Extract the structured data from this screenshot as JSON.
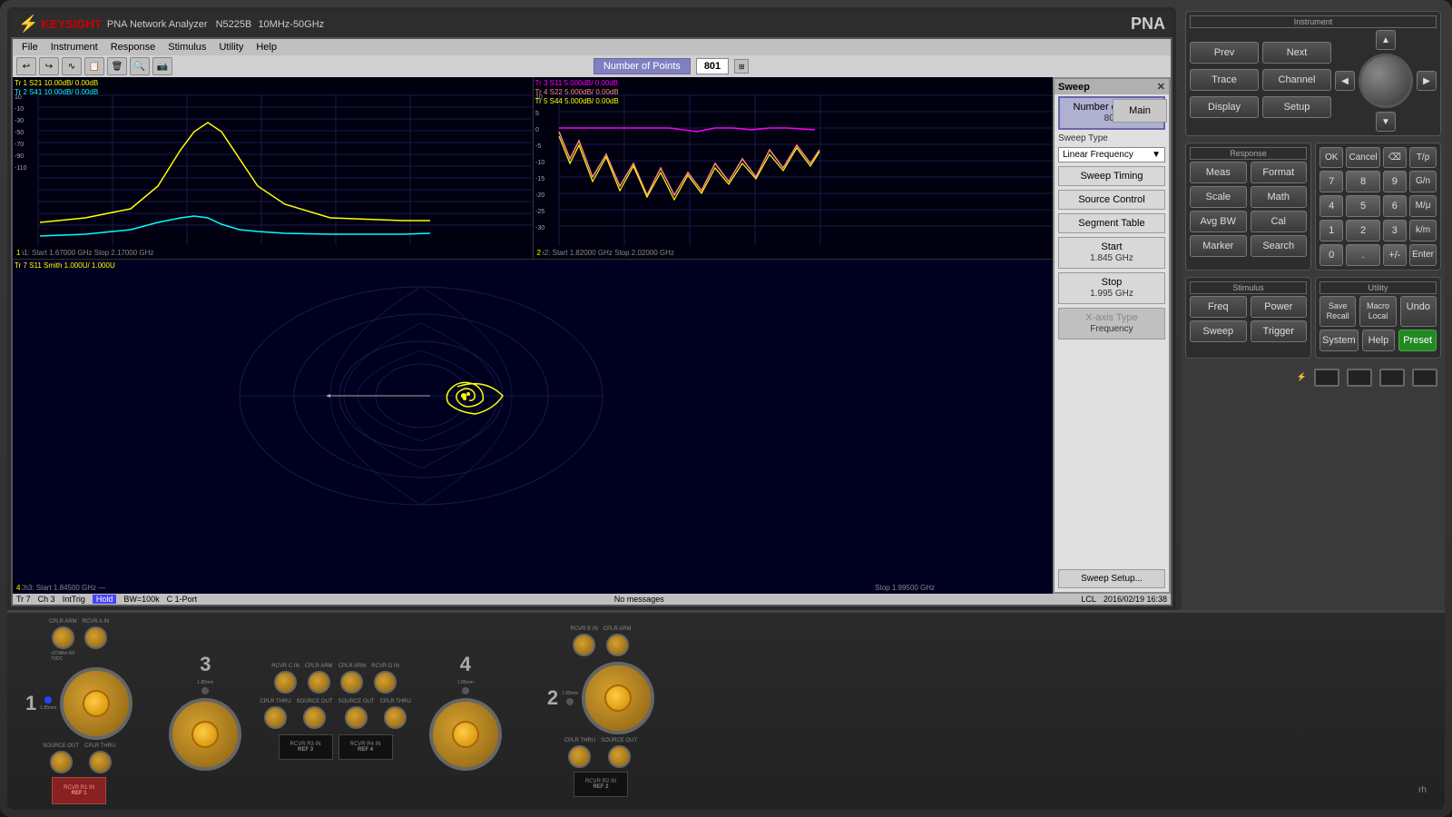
{
  "header": {
    "brand": "KEYSIGHT",
    "model": "PNA Network Analyzer",
    "series": "N5225B",
    "freq_range": "10MHz-50GHz",
    "pna_label": "PNA"
  },
  "menu": {
    "items": [
      "File",
      "Instrument",
      "Response",
      "Stimulus",
      "Utility",
      "Help"
    ]
  },
  "toolbar": {
    "buttons": [
      "↩",
      "↪",
      "〜",
      "📋",
      "🗑",
      "🔍",
      "📷"
    ]
  },
  "nop_bar": {
    "label": "Number of Points",
    "value": "801"
  },
  "sweep_panel": {
    "title": "Sweep",
    "close": "✕",
    "nop_label": "Number of Points",
    "nop_value": "801",
    "sweep_type_label": "Sweep Type",
    "sweep_type_value": "Linear Frequency",
    "main_btn": "Main",
    "sweep_timing_btn": "Sweep Timing",
    "source_control_btn": "Source Control",
    "segment_table_btn": "Segment Table",
    "start_label": "Start",
    "start_value": "1.845 GHz",
    "stop_label": "Stop",
    "stop_value": "1.995 GHz",
    "x_axis_label": "X-axis Type",
    "x_axis_value": "Frequency",
    "sweep_setup_btn": "Sweep Setup..."
  },
  "charts": {
    "chart1": {
      "trace1": "Tr 1  S21 10.00dB/ 0.00dB",
      "trace2": "Tr 2  S41 10.00dB/ 0.00dB",
      "bottom": "Ch1: Start 1.67000 GHz      Stop 2.17000 GHz"
    },
    "chart2": {
      "trace3": "Tr 3  S11 5.000dB/ 0.00dB",
      "trace4": "Tr 4  S22 5.000dB/ 0.00dB",
      "trace5": "Tr 5  S44 5.000dB/ 0.00dB",
      "bottom": "Ch2: Start 1.82000 GHz      Stop 2.02000 GHz"
    },
    "chart3": {
      "trace": "Tr 7   S11 Smith 1.000U/ 1.000U",
      "bottom_left": ">Ch3: Start 1.84500 GHz —",
      "bottom_right": "Stop 1.99500 GHz"
    }
  },
  "status_bar": {
    "items": [
      "Tr 7",
      "Ch 3",
      "IntTrig",
      "Hold",
      "BW=100k",
      "C 1-Port",
      "No messages",
      "LCL",
      "2016/02/19 16:38"
    ]
  },
  "instrument_panel": {
    "section_label": "Instrument",
    "prev_btn": "Prev",
    "next_btn": "Next",
    "trace_btn": "Trace",
    "channel_btn": "Channel",
    "display_btn": "Display",
    "setup_btn": "Setup"
  },
  "response_panel": {
    "section_label": "Response",
    "meas_btn": "Meas",
    "format_btn": "Format",
    "scale_btn": "Scale",
    "math_btn": "Math",
    "avg_bw_btn": "Avg BW",
    "cal_btn": "Cal",
    "marker_btn": "Marker",
    "search_btn": "Search"
  },
  "keypad": {
    "ok_btn": "OK",
    "cancel_btn": "Cancel",
    "backspace_btn": "⌫",
    "tp_btn": "T/p",
    "k7": "7",
    "k8": "8",
    "k9": "9",
    "gn_btn": "G/n",
    "k4": "4",
    "k5": "5",
    "k6": "6",
    "mu_btn": "M/μ",
    "k1": "1",
    "k2": "2",
    "k3": "3",
    "km_btn": "k/m",
    "k0": "0",
    "dot_btn": ".",
    "plusminus_btn": "+/-",
    "enter_btn": "Enter"
  },
  "stimulus_panel": {
    "section_label": "Stimulus",
    "freq_btn": "Freq",
    "power_btn": "Power",
    "sweep_btn": "Sweep",
    "trigger_btn": "Trigger"
  },
  "utility_panel": {
    "section_label": "Utility",
    "save_recall_btn": "Save\nRecall",
    "macro_local_btn": "Macro\nLocal",
    "undo_btn": "Undo",
    "system_btn": "System",
    "help_btn": "Help",
    "preset_btn": "Preset"
  },
  "ports": {
    "port1": "1",
    "port2": "2",
    "port3": "3",
    "port4": "4"
  },
  "connector_labels": {
    "cplr_arm": "CPLR ARM",
    "rcvr_a_in": "RCVR A IN",
    "source_out": "SOURCE OUT",
    "cplr_thru": "CPLR THRU",
    "rcvr_r1_in": "RCVR R1 IN",
    "ref1": "REF 1",
    "ref2": "REF 2",
    "ref3": "REF 3",
    "ref4": "REF 4"
  },
  "colors": {
    "accent": "#cc0000",
    "background": "#2d2d2d",
    "screen_bg": "#000010",
    "panel_btn": "#555555",
    "preset_green": "#228822",
    "hold_blue": "#3333cc",
    "trace_yellow": "#ffff00",
    "trace_cyan": "#00ffff",
    "trace_magenta": "#ff00ff",
    "trace_pink": "#ff8888"
  }
}
